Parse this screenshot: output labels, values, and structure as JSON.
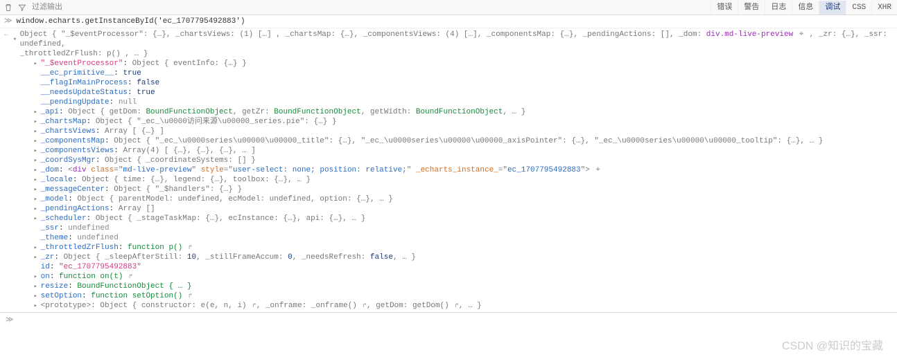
{
  "toolbar": {
    "filter_placeholder": "过滤输出",
    "tabs": [
      "错误",
      "警告",
      "日志",
      "信息",
      "调试",
      "CSS",
      "XHR"
    ],
    "active_tab": "调试"
  },
  "command": "window.echarts.getInstanceById('ec_1707795492883')",
  "top_summary": {
    "prefix": "Object { ",
    "items": "\"_$eventProcessor\": {…}, _chartsViews: (1) […] , _chartsMap: {…}, _componentsViews: (4) […], _componentsMap: {…}, _pendingActions: [], _dom: ",
    "dom": "div.md-live-preview",
    "after": ", _zr: {…}, _ssr: undefined,",
    "line2": "_throttledZrFlush: p() , … }"
  },
  "rows": [
    {
      "d": true,
      "i": 2,
      "raw": "<span class='k-str'>\"_$eventProcessor\"</span>: <span class='k-obj'>Object { eventInfo: {…} }</span>"
    },
    {
      "d": false,
      "i": 2,
      "raw": "<span class='k-key'>__ec_primitive__</span>: <span class='k-bool'>true</span>"
    },
    {
      "d": false,
      "i": 2,
      "raw": "<span class='k-key'>__flagInMainProcess</span>: <span class='k-bool'>false</span>"
    },
    {
      "d": false,
      "i": 2,
      "raw": "<span class='k-key'>__needsUpdateStatus</span>: <span class='k-bool'>true</span>"
    },
    {
      "d": false,
      "i": 2,
      "raw": "<span class='k-key'>__pendingUpdate</span>: <span class='k-null'>null</span>"
    },
    {
      "d": true,
      "i": 2,
      "raw": "<span class='k-key'>_api</span>: <span class='k-obj'>Object { getDom: <span class='k-func'>BoundFunctionObject</span>, getZr: <span class='k-func'>BoundFunctionObject</span>, getWidth: <span class='k-func'>BoundFunctionObject</span>, … }</span>"
    },
    {
      "d": true,
      "i": 2,
      "raw": "<span class='k-key'>_chartsMap</span>: <span class='k-obj'>Object { \"_ec_\\u0000访问来源\\u00000_series.pie\": {…} }</span>"
    },
    {
      "d": true,
      "i": 2,
      "raw": "<span class='k-key'>_chartsViews</span>: <span class='k-obj'>Array [ {…} ]</span>"
    },
    {
      "d": true,
      "i": 2,
      "raw": "<span class='k-key'>_componentsMap</span>: <span class='k-obj'>Object { \"_ec_\\u0000series\\u00000\\u00000_title\": {…}, \"_ec_\\u0000series\\u00000\\u00000_axisPointer\": {…}, \"_ec_\\u0000series\\u00000\\u00000_tooltip\": {…}, … }</span>"
    },
    {
      "d": true,
      "i": 2,
      "raw": "<span class='k-key'>_componentsViews</span>: <span class='k-obj'>Array(4) [ {…}, {…}, {…}, … ]</span>"
    },
    {
      "d": true,
      "i": 2,
      "raw": "<span class='k-key'>_coordSysMgr</span>: <span class='k-obj'>Object { _coordinateSystems: [] }</span>"
    },
    {
      "d": true,
      "i": 2,
      "raw": "<span class='k-key'>_dom</span>: <span class='k-obj'>&lt;<span class='k-tag'>div</span> <span class='k-attr'>class</span>=\"<span class='k-attrv'>md-live-preview</span>\" <span class='k-attr'>style</span>=\"<span class='k-attrv'>user-select: none; position: relative;</span>\" <span class='k-attr'>_echarts_instance_</span>=\"<span class='k-attrv'>ec_1707795492883</span>\"&gt;</span> <span class='target-icon' data-name='node-picker-icon' data-interactable='true'>⌖</span>"
    },
    {
      "d": true,
      "i": 2,
      "raw": "<span class='k-key'>_locale</span>: <span class='k-obj'>Object { time: {…}, legend: {…}, toolbox: {…}, … }</span>"
    },
    {
      "d": true,
      "i": 2,
      "raw": "<span class='k-key'>_messageCenter</span>: <span class='k-obj'>Object { \"_$handlers\": {…} }</span>"
    },
    {
      "d": true,
      "i": 2,
      "raw": "<span class='k-key'>_model</span>: <span class='k-obj'>Object { parentModel: undefined, ecModel: undefined, option: {…}, … }</span>"
    },
    {
      "d": true,
      "i": 2,
      "raw": "<span class='k-key'>_pendingActions</span>: <span class='k-obj'>Array []</span>"
    },
    {
      "d": true,
      "i": 2,
      "raw": "<span class='k-key'>_scheduler</span>: <span class='k-obj'>Object { _stageTaskMap: {…}, ecInstance: {…}, api: {…}, … }</span>"
    },
    {
      "d": false,
      "i": 2,
      "raw": "<span class='k-key'>_ssr</span>: <span class='k-undef'>undefined</span>"
    },
    {
      "d": false,
      "i": 2,
      "raw": "<span class='k-key'>_theme</span>: <span class='k-undef'>undefined</span>"
    },
    {
      "d": true,
      "i": 2,
      "raw": "<span class='k-key'>_throttledZrFlush</span>: <span class='k-func'>function p()</span> <span class='jump'>↱</span>"
    },
    {
      "d": true,
      "i": 2,
      "raw": "<span class='k-key'>_zr</span>: <span class='k-obj'>Object { _sleepAfterStill: <span class='k-num'>10</span>, _stillFrameAccum: <span class='k-num'>0</span>, _needsRefresh: <span class='k-bool'>false</span>, … }</span>"
    },
    {
      "d": false,
      "i": 2,
      "raw": "<span class='k-key'>id</span>: <span class='k-str'>\"ec_1707795492883\"</span>"
    },
    {
      "d": true,
      "i": 2,
      "raw": "<span class='k-key'>on</span>: <span class='k-func'>function on(t)</span> <span class='jump'>↱</span>"
    },
    {
      "d": true,
      "i": 2,
      "raw": "<span class='k-key'>resize</span>: <span class='k-func'>BoundFunctionObject { … }</span>"
    },
    {
      "d": true,
      "i": 2,
      "raw": "<span class='k-key'>setOption</span>: <span class='k-func'>function setOption()</span> <span class='jump'>↱</span>"
    },
    {
      "d": true,
      "i": 2,
      "raw": "<span class='k-obj'>&lt;prototype&gt;: Object { constructor: e(e, n, i) <span class='jump'>↱</span>, _onframe: _onframe() <span class='jump'>↱</span>, getDom: getDom() <span class='jump'>↱</span>, … }</span>"
    }
  ],
  "watermark": "CSDN @知识的宝藏"
}
